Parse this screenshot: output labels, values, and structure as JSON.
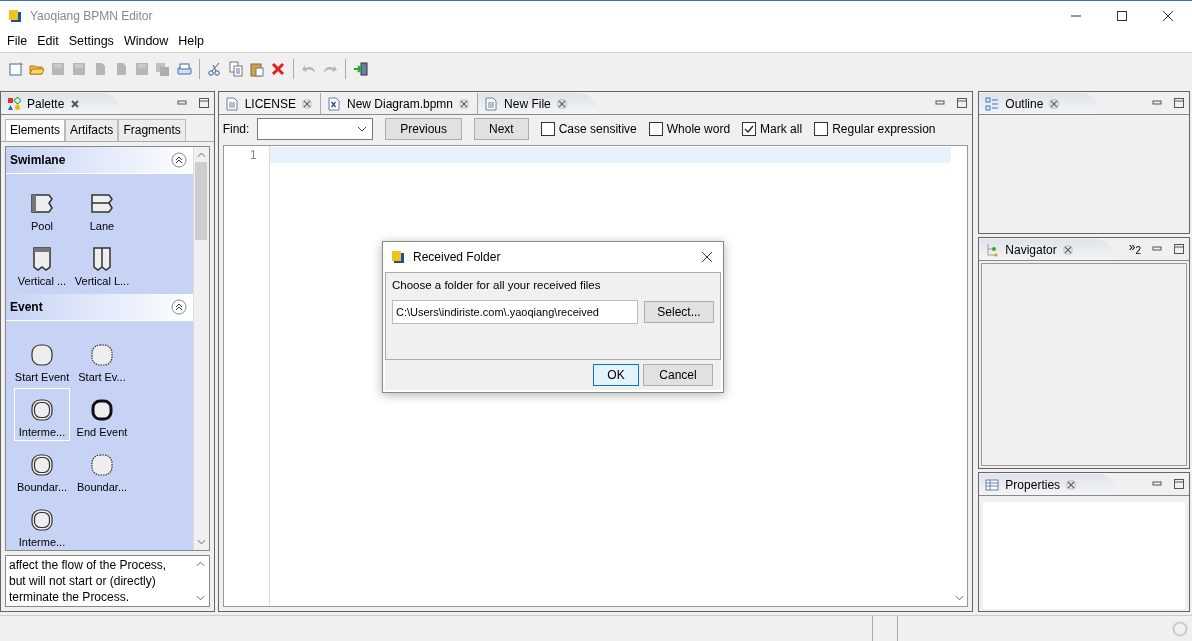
{
  "window": {
    "title": "Yaoqiang BPMN Editor"
  },
  "menu": [
    "File",
    "Edit",
    "Settings",
    "Window",
    "Help"
  ],
  "toolbar": [
    {
      "kind": "new",
      "disabled": false
    },
    {
      "kind": "open",
      "disabled": false
    },
    {
      "kind": "save",
      "disabled": true
    },
    {
      "kind": "save",
      "disabled": true
    },
    {
      "kind": "page",
      "disabled": true
    },
    {
      "kind": "page",
      "disabled": true
    },
    {
      "kind": "save",
      "disabled": true
    },
    {
      "kind": "copies",
      "disabled": true
    },
    {
      "kind": "print",
      "disabled": false
    },
    {
      "kind": "sep"
    },
    {
      "kind": "cut",
      "disabled": false
    },
    {
      "kind": "copy",
      "disabled": false
    },
    {
      "kind": "paste",
      "disabled": false
    },
    {
      "kind": "delete",
      "disabled": false
    },
    {
      "kind": "sep"
    },
    {
      "kind": "undo",
      "disabled": true
    },
    {
      "kind": "redo",
      "disabled": true
    },
    {
      "kind": "sep"
    },
    {
      "kind": "exit",
      "disabled": false
    }
  ],
  "palette": {
    "title": "Palette",
    "tabs": [
      {
        "label": "Elements",
        "selected": true
      },
      {
        "label": "Artifacts",
        "selected": false
      },
      {
        "label": "Fragments",
        "selected": false
      }
    ],
    "sections": [
      {
        "title": "Swimlane",
        "items": [
          {
            "label": "Pool",
            "kind": "pool",
            "selected": false
          },
          {
            "label": "Lane",
            "kind": "lane",
            "selected": false
          },
          {
            "label": "Vertical ...",
            "kind": "vpool",
            "selected": false
          },
          {
            "label": "Vertical L...",
            "kind": "vlane",
            "selected": false
          }
        ]
      },
      {
        "title": "Event",
        "items": [
          {
            "label": "Start Event",
            "kind": "start",
            "selected": false
          },
          {
            "label": "Start Ev...",
            "kind": "dotted",
            "selected": false
          },
          {
            "label": "Interme...",
            "kind": "double",
            "selected": true
          },
          {
            "label": "End Event",
            "kind": "end",
            "selected": false
          },
          {
            "label": "Boundar...",
            "kind": "double",
            "selected": false
          },
          {
            "label": "Boundar...",
            "kind": "dotted",
            "selected": false
          },
          {
            "label": "Interme...",
            "kind": "double",
            "selected": false
          }
        ]
      }
    ],
    "description": "affect the flow of the Process,\nbut will not start or (directly)\nterminate the Process."
  },
  "editor": {
    "tabs": [
      {
        "label": "LICENSE",
        "kind": "text",
        "selected": false
      },
      {
        "label": "New Diagram.bpmn",
        "kind": "xml",
        "selected": false
      },
      {
        "label": "New File",
        "kind": "text",
        "selected": true
      }
    ],
    "find": {
      "label": "Find:",
      "buttons": [
        "Previous",
        "Next"
      ],
      "options": [
        {
          "label": "Case sensitive",
          "checked": false
        },
        {
          "label": "Whole word",
          "checked": false
        },
        {
          "label": "Mark all",
          "checked": true
        },
        {
          "label": "Regular expression",
          "checked": false
        }
      ]
    },
    "line_numbers": [
      "1"
    ]
  },
  "views": [
    {
      "title": "Outline",
      "kind": "outline"
    },
    {
      "title": "Navigator",
      "kind": "navigator",
      "overflow": "»$_{2}$"
    },
    {
      "title": "Properties",
      "kind": "properties"
    }
  ],
  "dialog": {
    "title": "Received Folder",
    "message": "Choose a folder for all your received files",
    "value": "C:\\Users\\indiriste.com\\.yaoqiang\\received",
    "select": "Select...",
    "ok": "OK",
    "cancel": "Cancel"
  }
}
